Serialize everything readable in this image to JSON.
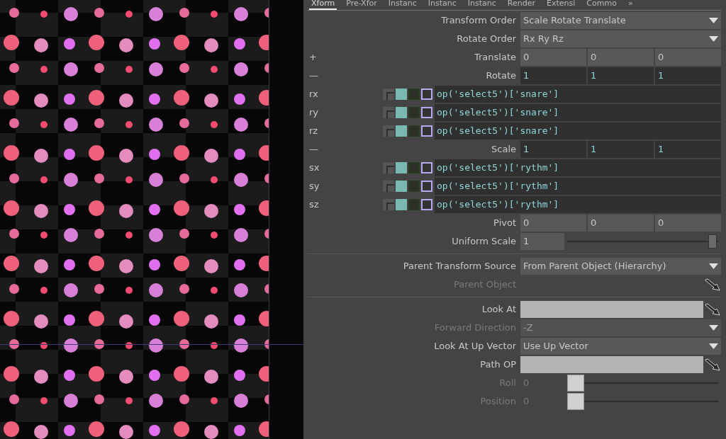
{
  "tabs": [
    {
      "label": "Xform",
      "selected": true
    },
    {
      "label": "Pre-Xfor",
      "selected": false
    },
    {
      "label": "Instanc",
      "selected": false
    },
    {
      "label": "Instanc",
      "selected": false
    },
    {
      "label": "Instanc",
      "selected": false
    },
    {
      "label": "Render",
      "selected": false
    },
    {
      "label": "Extensi",
      "selected": false
    },
    {
      "label": "Commo",
      "selected": false
    }
  ],
  "tabs_more": "»",
  "params": [
    {
      "kind": "menu",
      "label": "Transform Order",
      "value": "Scale Rotate Translate",
      "disabled": false
    },
    {
      "kind": "menu",
      "label": "Rotate Order",
      "value": "Rx Ry Rz",
      "disabled": false
    },
    {
      "kind": "vector",
      "toggle": "+",
      "label": "Translate",
      "expression_mode": false,
      "values": [
        "0",
        "0",
        "0"
      ]
    },
    {
      "kind": "vector",
      "toggle": "—",
      "label": "Rotate",
      "expression_mode": true,
      "values": [
        "1",
        "1",
        "1"
      ]
    },
    {
      "kind": "expr",
      "name": "rx",
      "expression": "op('select5')['snare']"
    },
    {
      "kind": "expr",
      "name": "ry",
      "expression": "op('select5')['snare']"
    },
    {
      "kind": "expr",
      "name": "rz",
      "expression": "op('select5')['snare']"
    },
    {
      "kind": "vector",
      "toggle": "—",
      "label": "Scale",
      "expression_mode": true,
      "values": [
        "1",
        "1",
        "1"
      ]
    },
    {
      "kind": "expr",
      "name": "sx",
      "expression": "op('select5')['rythm']"
    },
    {
      "kind": "expr",
      "name": "sy",
      "expression": "op('select5')['rythm']"
    },
    {
      "kind": "expr",
      "name": "sz",
      "expression": "op('select5')['rythm']"
    },
    {
      "kind": "vector",
      "label": "Pivot",
      "expression_mode": false,
      "values": [
        "0",
        "0",
        "0"
      ]
    },
    {
      "kind": "slider",
      "label": "Uniform Scale",
      "value": "1",
      "level": 1,
      "disabled": false
    },
    {
      "kind": "divider"
    },
    {
      "kind": "menu",
      "label": "Parent Transform Source",
      "value": "From Parent Object (Hierarchy)",
      "disabled": false
    },
    {
      "kind": "reference",
      "label": "Parent Object",
      "disabled": true
    },
    {
      "kind": "divider"
    },
    {
      "kind": "op",
      "label": "Look At",
      "disabled": false
    },
    {
      "kind": "menu",
      "label": "Forward Direction",
      "value": "-Z",
      "disabled": true
    },
    {
      "kind": "menu",
      "label": "Look At Up Vector",
      "value": "Use Up Vector",
      "disabled": false
    },
    {
      "kind": "op",
      "label": "Path OP",
      "disabled": false
    },
    {
      "kind": "slider",
      "label": "Roll",
      "value": "0",
      "level": 0,
      "disabled": true
    },
    {
      "kind": "slider",
      "label": "Position",
      "value": "0",
      "level": 0,
      "disabled": true
    }
  ]
}
